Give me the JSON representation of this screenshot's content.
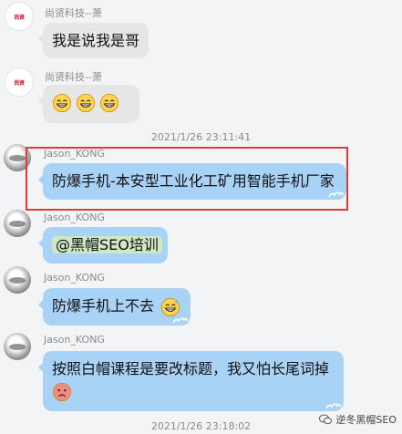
{
  "messages": [
    {
      "sender": "尚贤科技--萧",
      "text": "我是说我是哥",
      "avatar": "company-logo",
      "logo_text": "尚贤"
    },
    {
      "sender": "尚贤科技--萧",
      "text": "",
      "avatar": "company-logo",
      "logo_text": "尚贤",
      "emojis": [
        "grin-face",
        "grin-face",
        "grin-face"
      ]
    },
    {
      "timestamp": "2021/1/26 23:11:41"
    },
    {
      "sender": "Jason_KONG",
      "text": "防爆手机-本安型工业化工矿用智能手机厂家",
      "avatar": "ink-portrait"
    },
    {
      "sender": "Jason_KONG",
      "text": "@黑帽SEO培训",
      "avatar": "ink-portrait"
    },
    {
      "sender": "Jason_KONG",
      "text": "防爆手机上不去",
      "avatar": "ink-portrait",
      "emojis": [
        "grin-sweat-face"
      ]
    },
    {
      "sender": "Jason_KONG",
      "text": "按照白帽课程是要改标题，我又怕长尾词掉",
      "avatar": "ink-portrait",
      "emojis": [
        "red-sad-face"
      ]
    },
    {
      "timestamp": "2021/1/26 23:18:02"
    }
  ],
  "watermark": {
    "text": "逆冬黑帽SEO",
    "icon": "wechat-icon"
  },
  "colors": {
    "bubble_blue": "#a9d3f6",
    "bubble_gray": "#e6e6e6",
    "highlight": "#e03a3a"
  }
}
